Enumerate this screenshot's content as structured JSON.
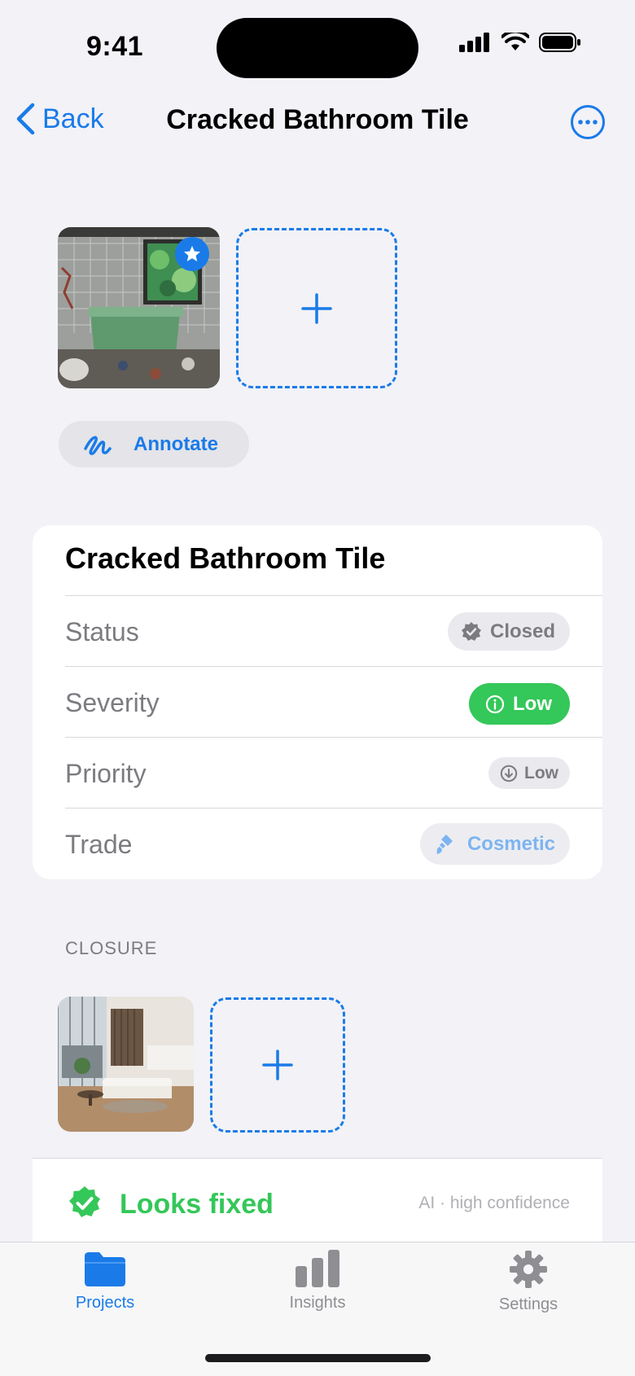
{
  "status_bar": {
    "time": "9:41"
  },
  "nav": {
    "back_label": "Back",
    "title": "Cracked Bathroom Tile"
  },
  "photos": {
    "main_photo_alt": "Bathroom with cracked tile",
    "annotate_label": "Annotate"
  },
  "card": {
    "title": "Cracked Bathroom Tile",
    "rows": [
      {
        "label": "Status",
        "value": "Closed"
      },
      {
        "label": "Severity",
        "value": "Low"
      },
      {
        "label": "Priority",
        "value": "Low"
      },
      {
        "label": "Trade",
        "value": "Cosmetic"
      }
    ]
  },
  "closure": {
    "section_label": "CLOSURE",
    "verdict": "Looks fixed",
    "confidence": "AI · high confidence"
  },
  "tabs": [
    {
      "label": "Projects",
      "icon": "folder-icon",
      "active": true
    },
    {
      "label": "Insights",
      "icon": "bar-chart-icon",
      "active": false
    },
    {
      "label": "Settings",
      "icon": "gear-icon",
      "active": false
    }
  ],
  "colors": {
    "accent": "#1A7BE8",
    "success": "#34C759",
    "background": "#F2F2F7",
    "secondary_text": "#7B7B80"
  }
}
